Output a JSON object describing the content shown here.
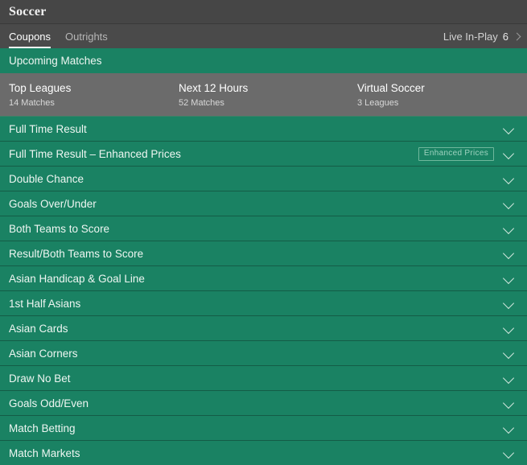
{
  "header": {
    "title": "Soccer"
  },
  "tabs": [
    {
      "label": "Coupons",
      "active": true
    },
    {
      "label": "Outrights",
      "active": false
    }
  ],
  "inplay": {
    "label": "Live In-Play",
    "count": "6",
    "chevron_icon": "chevron-right-icon"
  },
  "banner": {
    "label": "Upcoming Matches"
  },
  "subnav": [
    {
      "title": "Top Leagues",
      "subtitle": "14 Matches"
    },
    {
      "title": "Next 12 Hours",
      "subtitle": "52 Matches"
    },
    {
      "title": "Virtual Soccer",
      "subtitle": "3 Leagues"
    }
  ],
  "markets": [
    {
      "label": "Full Time Result",
      "badge": null,
      "chevron_icon": "chevron-down-icon"
    },
    {
      "label": "Full Time Result – Enhanced Prices",
      "badge": "Enhanced Prices",
      "chevron_icon": "chevron-down-icon"
    },
    {
      "label": "Double Chance",
      "badge": null,
      "chevron_icon": "chevron-down-icon"
    },
    {
      "label": "Goals Over/Under",
      "badge": null,
      "chevron_icon": "chevron-down-icon"
    },
    {
      "label": "Both Teams to Score",
      "badge": null,
      "chevron_icon": "chevron-down-icon"
    },
    {
      "label": "Result/Both Teams to Score",
      "badge": null,
      "chevron_icon": "chevron-down-icon"
    },
    {
      "label": "Asian Handicap & Goal Line",
      "badge": null,
      "chevron_icon": "chevron-down-icon"
    },
    {
      "label": "1st Half Asians",
      "badge": null,
      "chevron_icon": "chevron-down-icon"
    },
    {
      "label": "Asian Cards",
      "badge": null,
      "chevron_icon": "chevron-down-icon"
    },
    {
      "label": "Asian Corners",
      "badge": null,
      "chevron_icon": "chevron-down-icon"
    },
    {
      "label": "Draw No Bet",
      "badge": null,
      "chevron_icon": "chevron-down-icon"
    },
    {
      "label": "Goals Odd/Even",
      "badge": null,
      "chevron_icon": "chevron-down-icon"
    },
    {
      "label": "Match Betting",
      "badge": null,
      "chevron_icon": "chevron-down-icon"
    },
    {
      "label": "Match Markets",
      "badge": null,
      "chevron_icon": "chevron-down-icon"
    }
  ],
  "colors": {
    "brand_green": "#1a8263",
    "header_dark": "#464646",
    "tabbar_dark": "#4a4a4a",
    "subnav_gray": "#6b6b6b",
    "divider_green": "#145c46",
    "badge_border": "#6fb79c"
  }
}
